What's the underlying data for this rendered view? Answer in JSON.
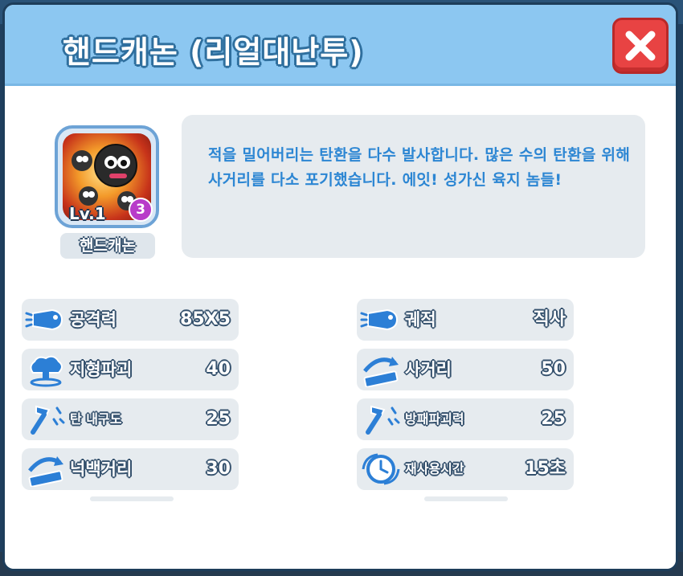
{
  "dialog": {
    "title": "핸드캐논 (리얼대난투)",
    "close_icon": "close-x-icon"
  },
  "item": {
    "name": "핸드캐논",
    "level": "Lv.1",
    "count": "3",
    "icon": "hand-cannon-icon"
  },
  "description": "적을 밀어버리는 탄환을 다수 발사합니다. 많은 수의 탄환을 위해 사거리를 다소 포기했습니다. 에잇! 성가신 육지 놈들!",
  "stats_left": [
    {
      "label": "공격력",
      "value": "85X5",
      "icon": "bullet-icon"
    },
    {
      "label": "지형파괴",
      "value": "40",
      "icon": "explosion-icon"
    },
    {
      "label": "탄 내구도",
      "value": "25",
      "icon": "hammer-icon"
    },
    {
      "label": "넉백거리",
      "value": "30",
      "icon": "ruler-arrow-icon"
    }
  ],
  "stats_right": [
    {
      "label": "궤적",
      "value": "직사",
      "icon": "bullet-icon"
    },
    {
      "label": "사거리",
      "value": "50",
      "icon": "ruler-arrow-icon"
    },
    {
      "label": "방패파괴력",
      "value": "25",
      "icon": "hammer-icon"
    },
    {
      "label": "재사용시간",
      "value": "15초",
      "icon": "cooldown-clock-icon"
    }
  ],
  "colors": {
    "header": "#8cc7f1",
    "close_button": "#e84343",
    "description_text": "#2c86d3",
    "icon_blue": "#2c7fd6"
  }
}
